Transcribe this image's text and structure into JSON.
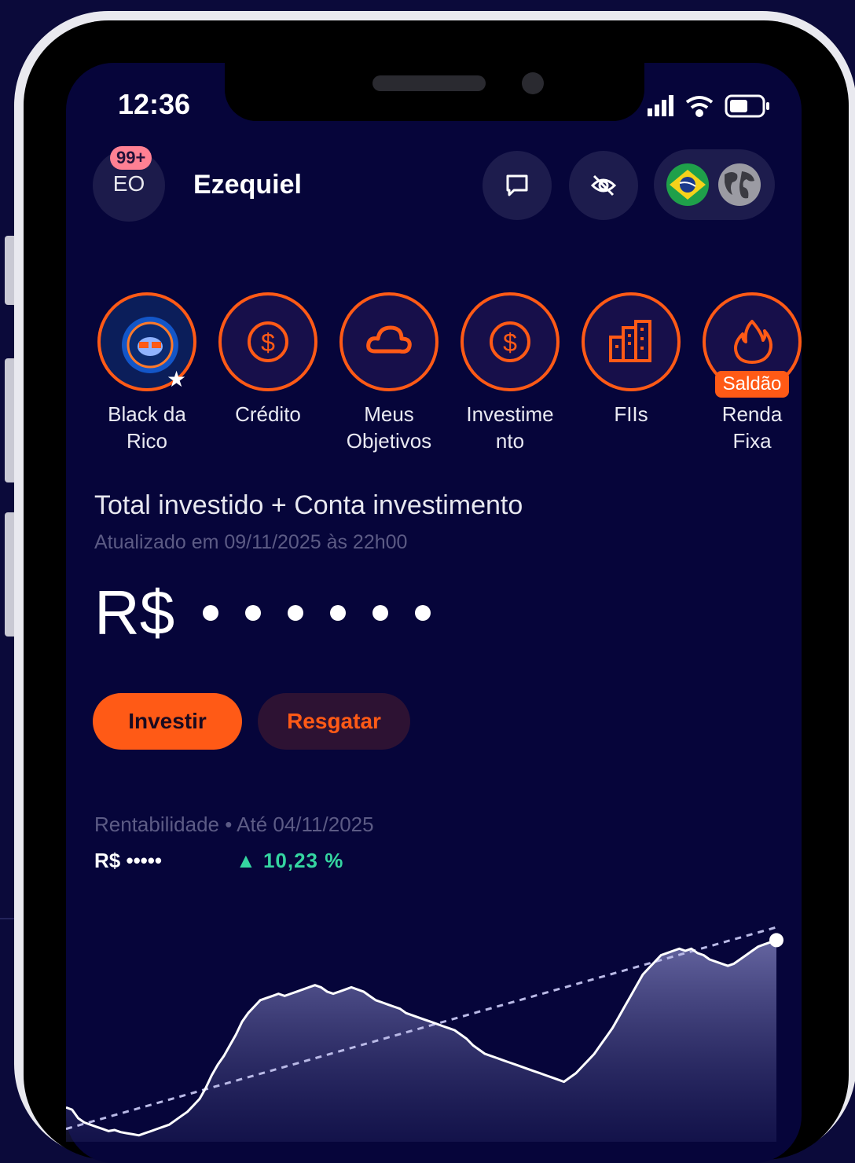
{
  "status_bar": {
    "time": "12:36"
  },
  "header": {
    "avatar_initials": "EO",
    "notification_badge": "99+",
    "username": "Ezequiel",
    "icons": [
      "message-icon",
      "eye-off-icon",
      "brazil-flag-icon",
      "globe-icon"
    ]
  },
  "shortcuts": [
    {
      "label": "Black da\nRico",
      "icon": "black-da-rico-promo-icon"
    },
    {
      "label": "Crédito",
      "icon": "dollar-coin-icon"
    },
    {
      "label": "Meus\nObjetivos",
      "icon": "cloud-icon"
    },
    {
      "label": "Investime\nnto",
      "icon": "dollar-coin-icon"
    },
    {
      "label": "FIIs",
      "icon": "buildings-icon"
    },
    {
      "label": "Renda\nFixa",
      "icon": "flame-icon",
      "tag": "Saldão"
    }
  ],
  "summary": {
    "title": "Total investido + Conta investimento",
    "updated": "Atualizado em 09/11/2025 às 22h00",
    "currency": "R$",
    "hidden_value_dots": 6
  },
  "actions": {
    "invest": "Investir",
    "redeem": "Resgatar"
  },
  "profitability": {
    "label": "Rentabilidade • Até 04/11/2025",
    "value": "R$ •••••",
    "percent": "▲ 10,23 %"
  },
  "colors": {
    "background": "#06053a",
    "accent": "#ff5a16",
    "positive": "#35d6a1",
    "muted_text": "#5c5b85"
  },
  "chart_data": {
    "type": "line",
    "title": "",
    "xlabel": "",
    "ylabel": "",
    "series": [
      {
        "values": [
          32,
          30,
          22,
          18,
          16,
          14,
          12,
          10,
          11,
          9,
          8,
          7,
          6,
          8,
          10,
          12,
          14,
          16,
          20,
          24,
          28,
          34,
          40,
          50,
          62,
          72,
          80,
          90,
          100,
          112,
          120,
          126,
          132,
          134,
          136,
          138,
          136,
          138,
          140,
          142,
          144,
          146,
          144,
          140,
          138,
          140,
          142,
          144,
          142,
          140,
          136,
          132,
          130,
          128,
          126,
          124,
          120,
          118,
          116,
          114,
          112,
          110,
          108,
          106,
          104,
          100,
          96,
          90,
          86,
          82,
          80,
          78,
          76,
          74,
          72,
          70,
          68,
          66,
          64,
          62,
          60,
          58,
          56,
          60,
          64,
          70,
          76,
          82,
          90,
          98,
          106,
          116,
          126,
          136,
          146,
          156,
          162,
          168,
          174,
          176,
          178,
          180,
          178,
          180,
          176,
          174,
          170,
          168,
          166,
          164,
          166,
          170,
          174,
          178,
          182,
          184,
          186,
          188
        ]
      }
    ],
    "trend_line": {
      "style": "dashed"
    },
    "grid": false,
    "legend": "none"
  }
}
